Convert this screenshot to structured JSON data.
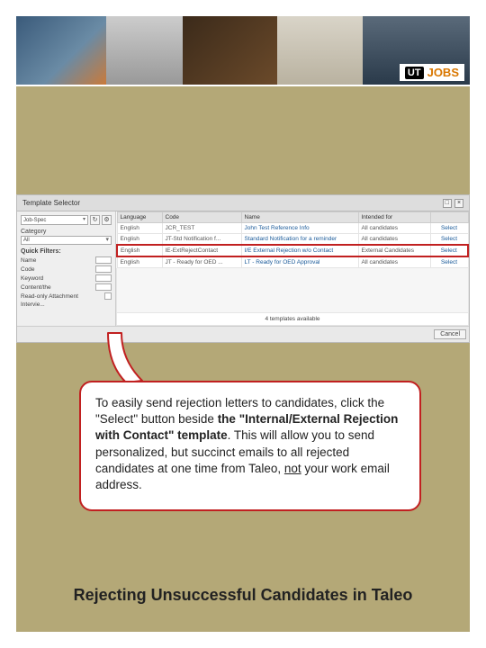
{
  "banner": {
    "logo_prefix": "UT",
    "logo_text": "JOBS"
  },
  "modal": {
    "title": "Template Selector",
    "left": {
      "picker": "Job-Spec",
      "refresh_icon": "↻",
      "search_icon": "⚙",
      "category_label": "Category",
      "category_value": "All",
      "quick_filters_label": "Quick Filters:",
      "filters": [
        {
          "label": "Name",
          "type": "drop"
        },
        {
          "label": "Code",
          "type": "drop"
        },
        {
          "label": "Keyword",
          "type": "drop"
        },
        {
          "label": "Content/the",
          "type": "drop"
        },
        {
          "label": "Read-only Attachment",
          "type": "check"
        },
        {
          "label": "Intervie..."
        }
      ]
    },
    "table": {
      "headers": [
        "Language",
        "Code",
        "Name",
        "Intended for",
        ""
      ],
      "rows": [
        {
          "Language": "English",
          "Code": "JCR_TEST",
          "Name": "John Test Reference Info",
          "Intended": "All candidates",
          "Action": "Select",
          "hl": false
        },
        {
          "Language": "English",
          "Code": "JT-Std Notification f...",
          "Name": "Standard Notification for a reminder",
          "Intended": "All candidates",
          "Action": "Select",
          "hl": false
        },
        {
          "Language": "English",
          "Code": "IE-ExtRejectContact",
          "Name": "I/E External Rejection w/o Contact",
          "Intended": "External Candidates",
          "Action": "Select",
          "hl": true
        },
        {
          "Language": "English",
          "Code": "JT - Ready for OED ...",
          "Name": "LT - Ready for OED Approval",
          "Intended": "All candidates",
          "Action": "Select",
          "hl": false
        }
      ],
      "status": "4 templates available"
    },
    "footer": {
      "cancel": "Cancel"
    }
  },
  "callout": {
    "pre": "To easily send rejection letters to candidates, click the \"Select\" button beside ",
    "bold": "the \"Internal/External Rejection with Contact\" template",
    "post1": ". This will allow you to send personalized, but succinct emails to all rejected candidates at one time from Taleo, ",
    "u": "not",
    "post2": " your work email address."
  },
  "footer_title": "Rejecting Unsuccessful Candidates in Taleo"
}
